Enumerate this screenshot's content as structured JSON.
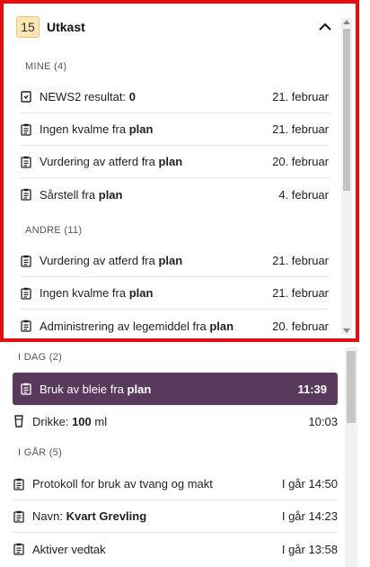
{
  "drafts": {
    "count": "15",
    "title": "Utkast",
    "sections": [
      {
        "label": "MINE (4)",
        "items": [
          {
            "icon": "report-icon",
            "text": "NEWS2 resultat: ",
            "bold": "0",
            "date": "21. februar"
          },
          {
            "icon": "clipboard-icon",
            "text": "Ingen kvalme fra ",
            "bold": "plan",
            "date": "21. februar"
          },
          {
            "icon": "clipboard-icon",
            "text": "Vurdering av atferd fra ",
            "bold": "plan",
            "date": "20. februar"
          },
          {
            "icon": "clipboard-icon",
            "text": "Sårstell fra ",
            "bold": "plan",
            "date": "4. februar"
          }
        ]
      },
      {
        "label": "ANDRE (11)",
        "items": [
          {
            "icon": "clipboard-icon",
            "text": "Vurdering av atferd fra ",
            "bold": "plan",
            "date": "21. februar"
          },
          {
            "icon": "clipboard-icon",
            "text": "Ingen kvalme fra ",
            "bold": "plan",
            "date": "21. februar"
          },
          {
            "icon": "clipboard-icon",
            "text": "Administrering av legemiddel fra ",
            "bold": "plan",
            "date": "20. februar"
          }
        ]
      }
    ]
  },
  "timeline": {
    "sections": [
      {
        "label": "I DAG (2)",
        "items": [
          {
            "icon": "clipboard-icon",
            "text": "Bruk av bleie fra ",
            "bold": "plan",
            "suffix": "",
            "date": "11:39",
            "selected": true
          },
          {
            "icon": "cup-icon",
            "text": "Drikke: ",
            "bold": "100",
            "suffix": " ml",
            "date": "10:03",
            "selected": false
          }
        ]
      },
      {
        "label": "I GÅR (5)",
        "items": [
          {
            "icon": "clipboard-icon",
            "text": "Protokoll for bruk av tvang og makt",
            "bold": "",
            "suffix": "",
            "date": "I går 14:50",
            "selected": false
          },
          {
            "icon": "clipboard-icon",
            "text": "Navn: ",
            "bold": "Kvart Grevling",
            "suffix": "",
            "date": "I går 14:23",
            "selected": false
          },
          {
            "icon": "clipboard-icon",
            "text": "Aktiver vedtak",
            "bold": "",
            "suffix": "",
            "date": "I går 13:58",
            "selected": false
          }
        ]
      }
    ]
  },
  "colors": {
    "highlight_border": "#e10f0f",
    "selected_row": "#5a3a5c",
    "badge_bg": "#fbe6b4"
  }
}
